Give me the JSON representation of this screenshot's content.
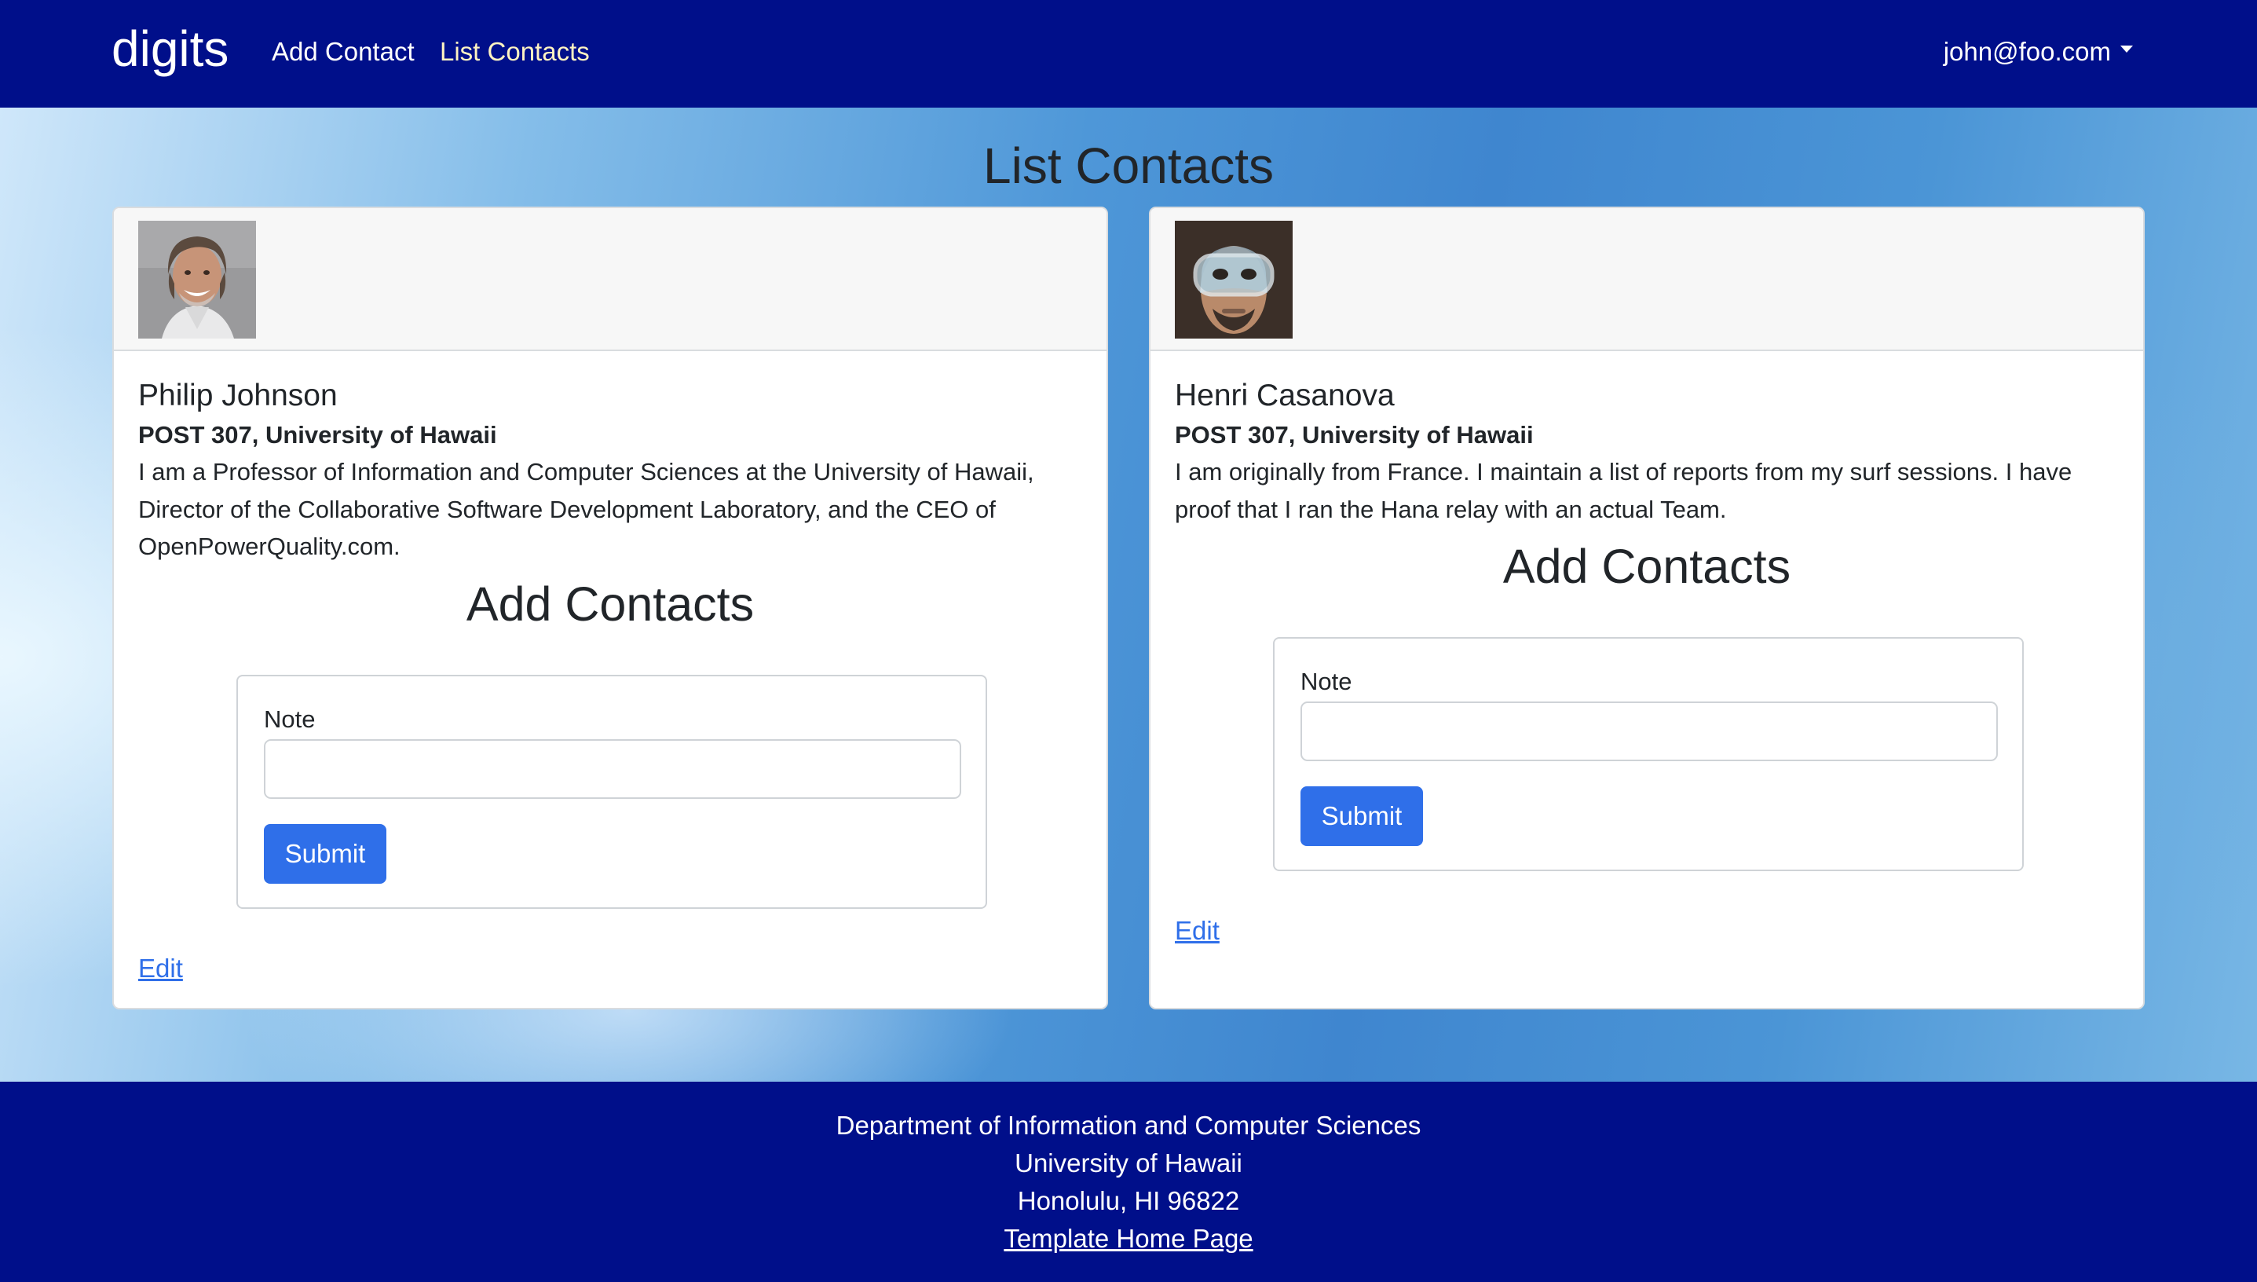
{
  "navbar": {
    "brand": "digits",
    "links": [
      {
        "label": "Add Contact"
      },
      {
        "label": "List Contacts"
      }
    ],
    "user_menu": "john@foo.com"
  },
  "page_title": "List Contacts",
  "contacts": [
    {
      "name": "Philip Johnson",
      "address": "POST 307, University of Hawaii",
      "description": "I am a Professor of Information and Computer Sciences at the University of Hawaii, Director of the Collaborative Software Development Laboratory, and the CEO of OpenPowerQuality.com.",
      "add_title": "Add Contacts",
      "note_label": "Note",
      "note_value": "",
      "submit_label": "Submit",
      "edit_label": "Edit"
    },
    {
      "name": "Henri Casanova",
      "address": "POST 307, University of Hawaii",
      "description": "I am originally from France. I maintain a list of reports from my surf sessions. I have proof that I ran the Hana relay with an actual Team.",
      "add_title": "Add Contacts",
      "note_label": "Note",
      "note_value": "",
      "submit_label": "Submit",
      "edit_label": "Edit"
    }
  ],
  "footer": {
    "line1": "Department of Information and Computer Sciences",
    "line2": "University of Hawaii",
    "line3": "Honolulu, HI 96822",
    "link": "Template Home Page"
  },
  "colors": {
    "navbar_bg": "#000f8a",
    "active_link": "#fff4c2",
    "button_primary": "#2f6fe9",
    "link": "#2f6fe9"
  }
}
